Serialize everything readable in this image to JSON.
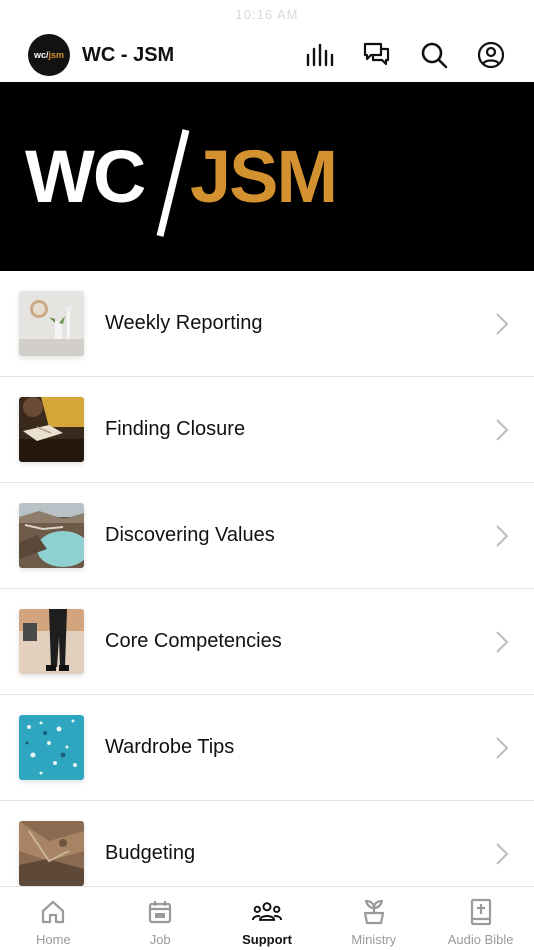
{
  "status_bar": {
    "time": "10:16 AM"
  },
  "header": {
    "logo_text": "wc/",
    "logo_accent": "jsm",
    "title": "WC - JSM",
    "icons": [
      "stats-icon",
      "chat-icon",
      "search-icon",
      "profile-icon"
    ]
  },
  "banner": {
    "left_text": "WC",
    "right_text": "JSM",
    "accent_color": "#d4912f"
  },
  "list": {
    "items": [
      {
        "label": "Weekly Reporting"
      },
      {
        "label": "Finding Closure"
      },
      {
        "label": "Discovering Values"
      },
      {
        "label": "Core Competencies"
      },
      {
        "label": "Wardrobe Tips"
      },
      {
        "label": "Budgeting"
      }
    ]
  },
  "tab_bar": {
    "tabs": [
      {
        "label": "Home",
        "icon": "home-icon"
      },
      {
        "label": "Job",
        "icon": "calendar-icon"
      },
      {
        "label": "Support",
        "icon": "group-icon"
      },
      {
        "label": "Ministry",
        "icon": "plant-icon"
      },
      {
        "label": "Audio Bible",
        "icon": "bible-icon"
      }
    ],
    "active": "Support"
  }
}
